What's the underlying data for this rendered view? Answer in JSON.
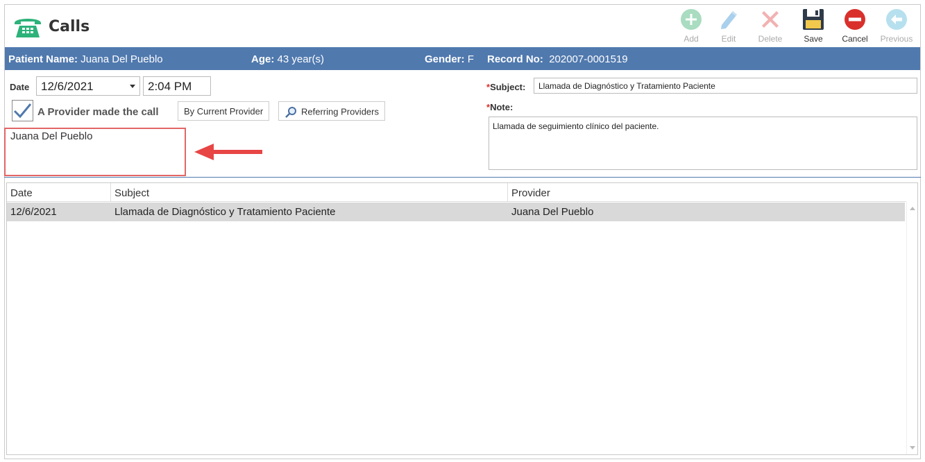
{
  "header": {
    "title": "Calls"
  },
  "toolbar": {
    "add": "Add",
    "edit": "Edit",
    "delete": "Delete",
    "save": "Save",
    "cancel": "Cancel",
    "previous": "Previous"
  },
  "patient": {
    "name_label": "Patient Name:",
    "name": "Juana Del Pueblo",
    "age_label": "Age:",
    "age": "43 year(s)",
    "gender_label": "Gender:",
    "gender": "F",
    "record_label": "Record No:",
    "record": "202007-0001519"
  },
  "form": {
    "date_label": "Date",
    "date_value": "12/6/2021",
    "time_value": "2:04 PM",
    "provider_checkbox_label": "A Provider made the call",
    "provider_checked": true,
    "by_current_provider": "By Current Provider",
    "referring_providers": "Referring Providers",
    "provider_name": "Juana  Del Pueblo",
    "required_mark": "*",
    "subject_label": "Subject:",
    "subject_value": "Llamada de Diagnóstico y Tratamiento Paciente",
    "note_label": "Note:",
    "note_value": "Llamada de seguimiento clínico del paciente."
  },
  "grid": {
    "columns": [
      "Date",
      "Subject",
      "Provider"
    ],
    "rows": [
      [
        "12/6/2021",
        "Llamada de Diagnóstico y Tratamiento Paciente",
        "Juana  Del Pueblo"
      ]
    ]
  },
  "colors": {
    "patient_bar": "#5079ae",
    "highlight_box": "#e26565",
    "required": "#d9302c",
    "selected_row": "#d9d9d9"
  }
}
